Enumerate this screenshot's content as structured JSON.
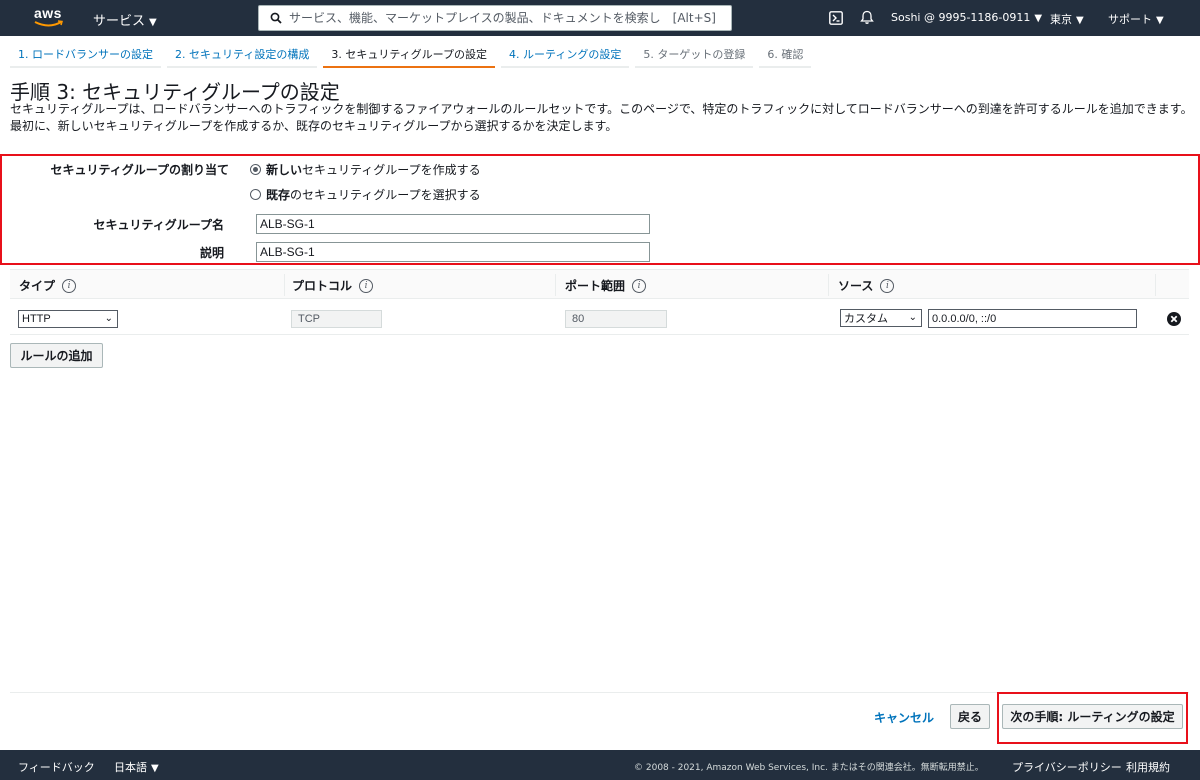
{
  "topnav": {
    "logo_text": "aws",
    "services_label": "サービス",
    "search_placeholder": "サービス、機能、マーケットプレイスの製品、ドキュメントを検索し　[Alt+S]",
    "account_label": "Soshi @ 9995-1186-0911",
    "region_label": "東京",
    "support_label": "サポート",
    "caret": "▼"
  },
  "steps": [
    {
      "label": "1. ロードバランサーの設定",
      "state": "link"
    },
    {
      "label": "2. セキュリティ設定の構成",
      "state": "link"
    },
    {
      "label": "3. セキュリティグループの設定",
      "state": "active"
    },
    {
      "label": "4. ルーティングの設定",
      "state": "link"
    },
    {
      "label": "5. ターゲットの登録",
      "state": "disabled"
    },
    {
      "label": "6. 確認",
      "state": "disabled"
    }
  ],
  "page": {
    "title": "手順 3: セキュリティグループの設定",
    "description": "セキュリティグループは、ロードバランサーへのトラフィックを制御するファイアウォールのルールセットです。このページで、特定のトラフィックに対してロードバランサーへの到達を許可するルールを追加できます。最初に、新しいセキュリティグループを作成するか、既存のセキュリティグループから選択するかを決定します。"
  },
  "assignment": {
    "label": "セキュリティグループの割り当て",
    "option_new_bold": "新しい",
    "option_new_rest": "セキュリティグループを作成する",
    "option_existing_bold": "既存",
    "option_existing_rest": "のセキュリティグループを選択する",
    "selected": "new",
    "name_label": "セキュリティグループ名",
    "name_value": "ALB-SG-1",
    "desc_label": "説明",
    "desc_value": "ALB-SG-1"
  },
  "rules_table": {
    "headers": [
      "タイプ",
      "プロトコル",
      "ポート範囲",
      "ソース"
    ],
    "info_glyph": "i",
    "rows": [
      {
        "type": "HTTP",
        "protocol": "TCP",
        "port_range": "80",
        "source_mode": "カスタム",
        "source_cidr": "0.0.0.0/0, ::/0"
      }
    ],
    "chevron": "⌄",
    "add_rule_label": "ルールの追加"
  },
  "actions": {
    "cancel_label": "キャンセル",
    "back_label": "戻る",
    "next_label": "次の手順: ルーティングの設定"
  },
  "footer": {
    "feedback_label": "フィードバック",
    "language_label": "日本語",
    "copyright": "© 2008 - 2021, Amazon Web Services, Inc. またはその関連会社。無断転用禁止。",
    "privacy_label": "プライバシーポリシー",
    "terms_label": "利用規約"
  },
  "colors": {
    "nav_bg": "#232f3e",
    "link": "#0073bb",
    "active_step_underline": "#ec7211",
    "highlight_outline": "#e8101a"
  }
}
